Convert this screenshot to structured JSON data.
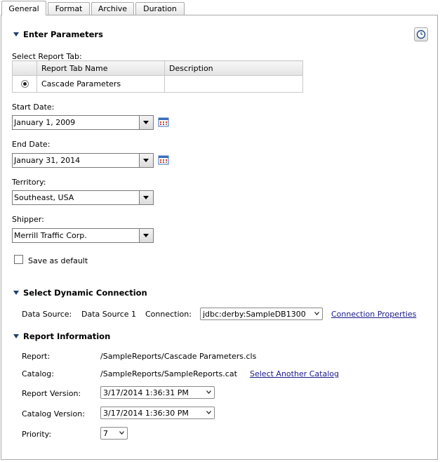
{
  "tabs": [
    "General",
    "Format",
    "Archive",
    "Duration"
  ],
  "enter_parameters": {
    "title": "Enter Parameters",
    "select_report_tab_label": "Select Report Tab:",
    "table_headers": [
      "Report Tab Name",
      "Description"
    ],
    "rows": [
      {
        "name": "Cascade Parameters",
        "description": ""
      }
    ],
    "start_date_label": "Start Date:",
    "start_date_value": "January 1, 2009",
    "end_date_label": "End Date:",
    "end_date_value": "January 31, 2014",
    "territory_label": "Territory:",
    "territory_value": "Southeast, USA",
    "shipper_label": "Shipper:",
    "shipper_value": "Merrill Traffic Corp.",
    "save_default_label": "Save as default"
  },
  "dynamic_connection": {
    "title": "Select Dynamic Connection",
    "data_source_label": "Data Source:",
    "data_source_value": "Data Source 1",
    "connection_label": "Connection:",
    "connection_value": "jdbc:derby:SampleDB1300",
    "properties_link": "Connection Properties"
  },
  "report_information": {
    "title": "Report Information",
    "report_label": "Report:",
    "report_value": "/SampleReports/Cascade Parameters.cls",
    "catalog_label": "Catalog:",
    "catalog_value": "/SampleReports/SampleReports.cat",
    "another_catalog_link": "Select Another Catalog",
    "report_version_label": "Report Version:",
    "report_version_value": "3/17/2014 1:36:31 PM",
    "catalog_version_label": "Catalog Version:",
    "catalog_version_value": "3/17/2014 1:36:30 PM",
    "priority_label": "Priority:",
    "priority_value": "7"
  },
  "icons": {
    "schedule": "clock-icon",
    "calendar": "calendar-icon",
    "collapse": "triangle-down-icon"
  },
  "colors": {
    "border": "#a9a9a9",
    "link": "#1a1a8c",
    "calendar_red": "#d03a2a",
    "calendar_blue": "#3a6fbf"
  }
}
